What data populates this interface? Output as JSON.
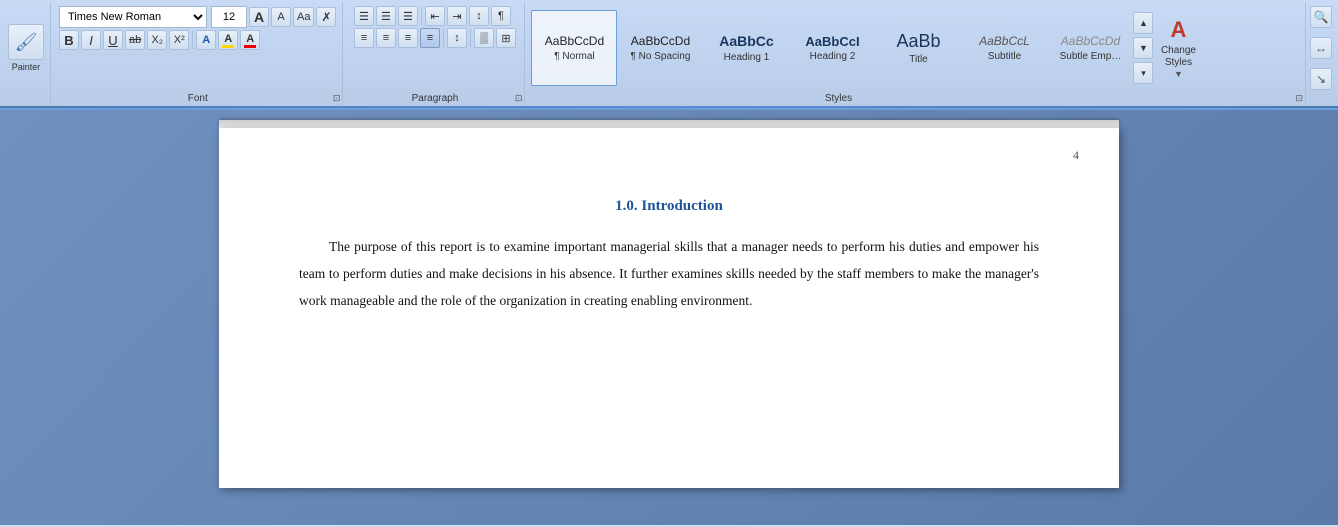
{
  "ribbon": {
    "font_group_label": "Font",
    "paragraph_group_label": "Paragraph",
    "styles_group_label": "Styles",
    "font_name": "Times New Roman",
    "font_size": "12",
    "format_painter_label": "Painter",
    "toolbar": {
      "bold": "B",
      "italic": "I",
      "underline": "U",
      "strikethrough": "ab",
      "subscript": "X₂",
      "superscript": "X²",
      "clear_format": "A",
      "font_color_label": "A",
      "highlight_label": "A"
    },
    "para_buttons": {
      "bullets": "☰",
      "numbering": "☰",
      "multilevel": "☰",
      "decrease_indent": "⇤",
      "increase_indent": "⇥",
      "sort": "↕",
      "show_para": "¶",
      "align_left": "≡",
      "align_center": "≡",
      "align_right": "≡",
      "justify": "≡",
      "line_spacing": "↕",
      "shading": "▒",
      "borders": "⊞"
    },
    "styles": [
      {
        "id": "normal",
        "preview": "AaBbCcDd",
        "label": "¶ Normal",
        "class": "style-normal"
      },
      {
        "id": "no-spacing",
        "preview": "AaBbCcDd",
        "label": "¶ No Spacing",
        "class": "style-no-spacing"
      },
      {
        "id": "heading1",
        "preview": "AaBbCc",
        "label": "Heading 1",
        "class": "style-heading1"
      },
      {
        "id": "heading2",
        "preview": "AaBbCcI",
        "label": "Heading 2",
        "class": "style-heading2"
      },
      {
        "id": "title",
        "preview": "AaBb",
        "label": "Title",
        "class": "style-title"
      },
      {
        "id": "subtitle",
        "preview": "AaBbCcL",
        "label": "Subtitle",
        "class": "style-subtitle"
      },
      {
        "id": "subtle-emph",
        "preview": "AaBbCcDd",
        "label": "Subtle Emp…",
        "class": "style-subtle-emph"
      }
    ],
    "change_styles_label": "Change\nStyles"
  },
  "document": {
    "page_number": "4",
    "heading": "1.0.\tIntroduction",
    "paragraph": "The purpose of this report is to examine important managerial skills that a manager needs to perform his duties and empower his team to perform duties and make decisions in his absence. It further examines skills needed by the staff members to make the manager's work manageable and the role of the organization in creating enabling environment."
  }
}
